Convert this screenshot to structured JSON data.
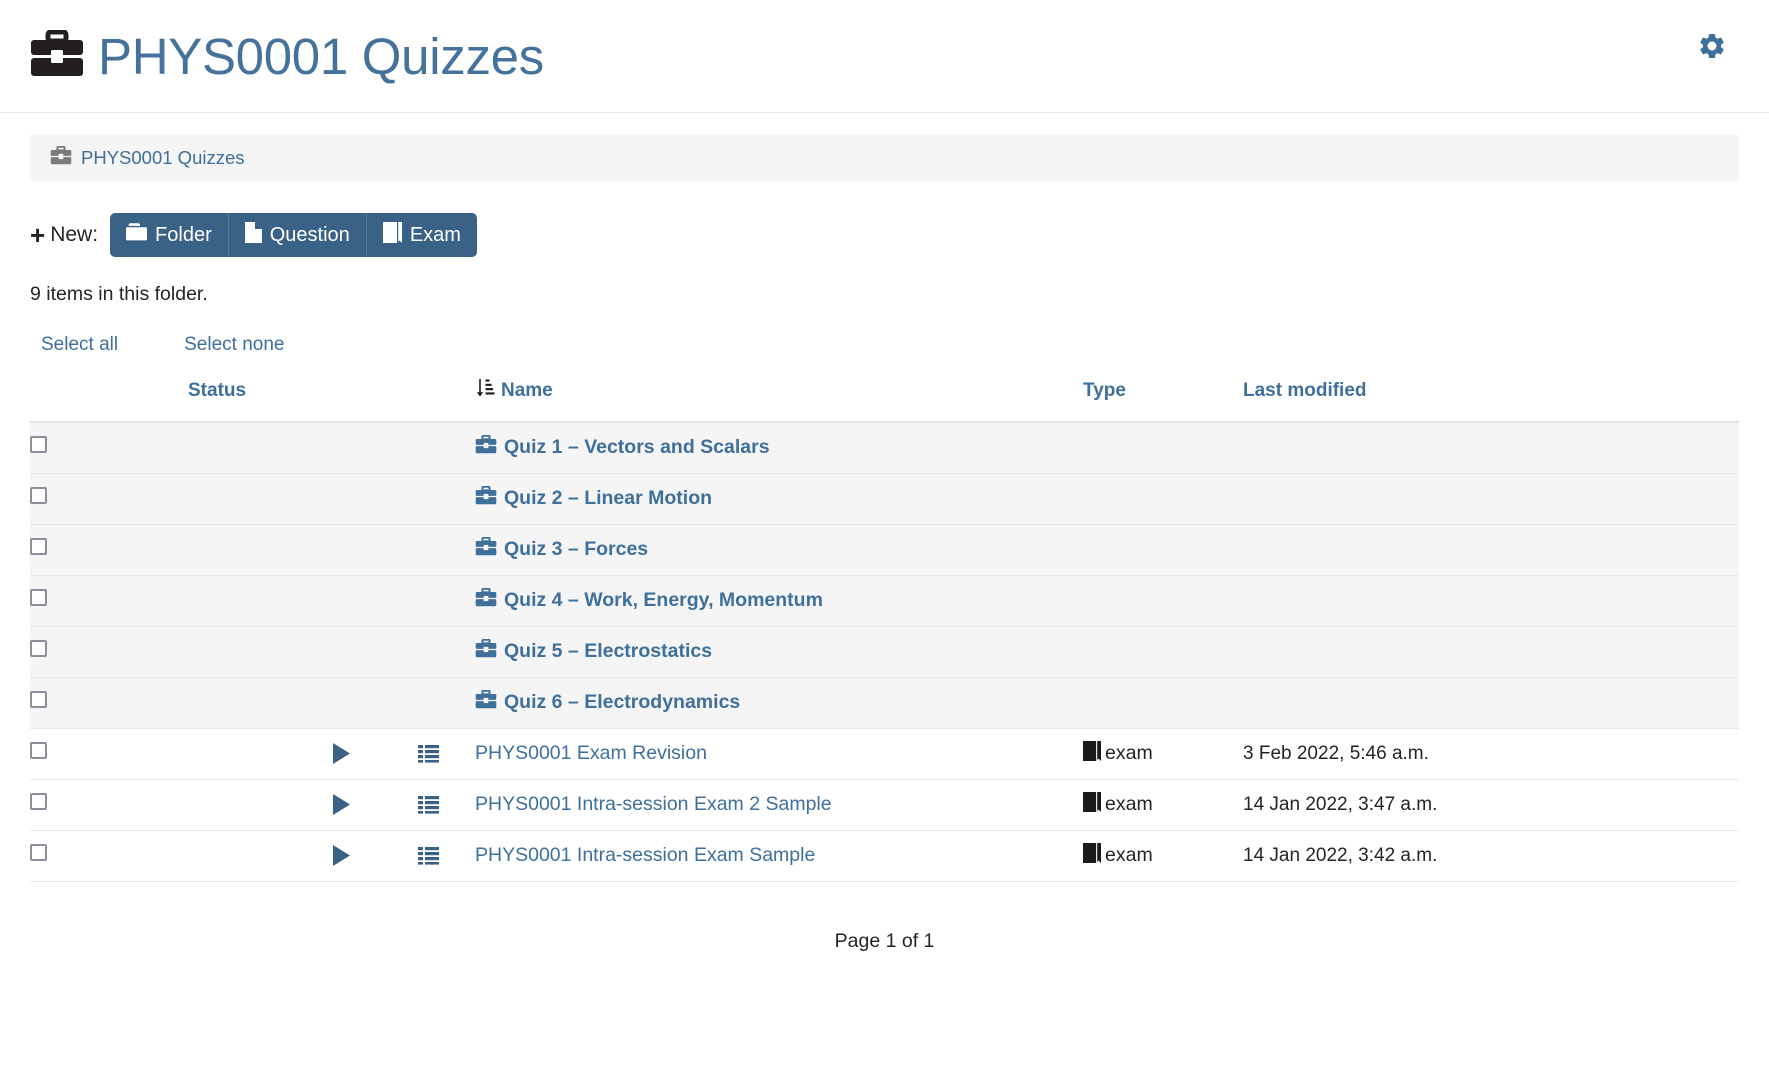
{
  "header": {
    "icon": "briefcase-icon",
    "title": "PHYS0001 Quizzes",
    "settings_icon": "gear-icon",
    "title_color": "#44729b"
  },
  "breadcrumb": {
    "icon": "briefcase-icon",
    "label": "PHYS0001 Quizzes"
  },
  "toolbar": {
    "plus": "+",
    "new_label": "New:",
    "buttons": [
      {
        "label": "Folder",
        "icon": "folder-icon"
      },
      {
        "label": "Question",
        "icon": "file-icon"
      },
      {
        "label": "Exam",
        "icon": "book-icon"
      }
    ],
    "button_color": "#3a6186"
  },
  "items_count_text": "9 items in this folder.",
  "selection": {
    "select_all": "Select all",
    "select_none": "Select none"
  },
  "table": {
    "headers": {
      "status": "Status",
      "name": "Name",
      "type": "Type",
      "last_modified": "Last modified",
      "sort_icon": "sort-amount-down-icon"
    },
    "rows": [
      {
        "kind": "folder",
        "name": "Quiz 1 – Vectors and Scalars",
        "name_icon": "briefcase-icon",
        "type": "",
        "type_icon": "",
        "last_modified": ""
      },
      {
        "kind": "folder",
        "name": "Quiz 2 – Linear Motion",
        "name_icon": "briefcase-icon",
        "type": "",
        "type_icon": "",
        "last_modified": ""
      },
      {
        "kind": "folder",
        "name": "Quiz 3 – Forces",
        "name_icon": "briefcase-icon",
        "type": "",
        "type_icon": "",
        "last_modified": ""
      },
      {
        "kind": "folder",
        "name": "Quiz 4 – Work, Energy, Momentum",
        "name_icon": "briefcase-icon",
        "type": "",
        "type_icon": "",
        "last_modified": ""
      },
      {
        "kind": "folder",
        "name": "Quiz 5 – Electrostatics",
        "name_icon": "briefcase-icon",
        "type": "",
        "type_icon": "",
        "last_modified": ""
      },
      {
        "kind": "folder",
        "name": "Quiz 6 – Electrodynamics",
        "name_icon": "briefcase-icon",
        "type": "",
        "type_icon": "",
        "last_modified": ""
      },
      {
        "kind": "exam",
        "name": "PHYS0001 Exam Revision",
        "name_icon": "list-icon",
        "status_icon": "play-icon",
        "type": "exam",
        "type_icon": "book-icon",
        "last_modified": "3 Feb 2022, 5:46 a.m."
      },
      {
        "kind": "exam",
        "name": "PHYS0001 Intra-session Exam 2 Sample",
        "name_icon": "list-icon",
        "status_icon": "play-icon",
        "type": "exam",
        "type_icon": "book-icon",
        "last_modified": "14 Jan 2022, 3:47 a.m."
      },
      {
        "kind": "exam",
        "name": "PHYS0001 Intra-session Exam Sample",
        "name_icon": "list-icon",
        "status_icon": "play-icon",
        "type": "exam",
        "type_icon": "book-icon",
        "last_modified": "14 Jan 2022, 3:42 a.m."
      }
    ]
  },
  "pagination": {
    "text": "Page 1 of 1"
  }
}
